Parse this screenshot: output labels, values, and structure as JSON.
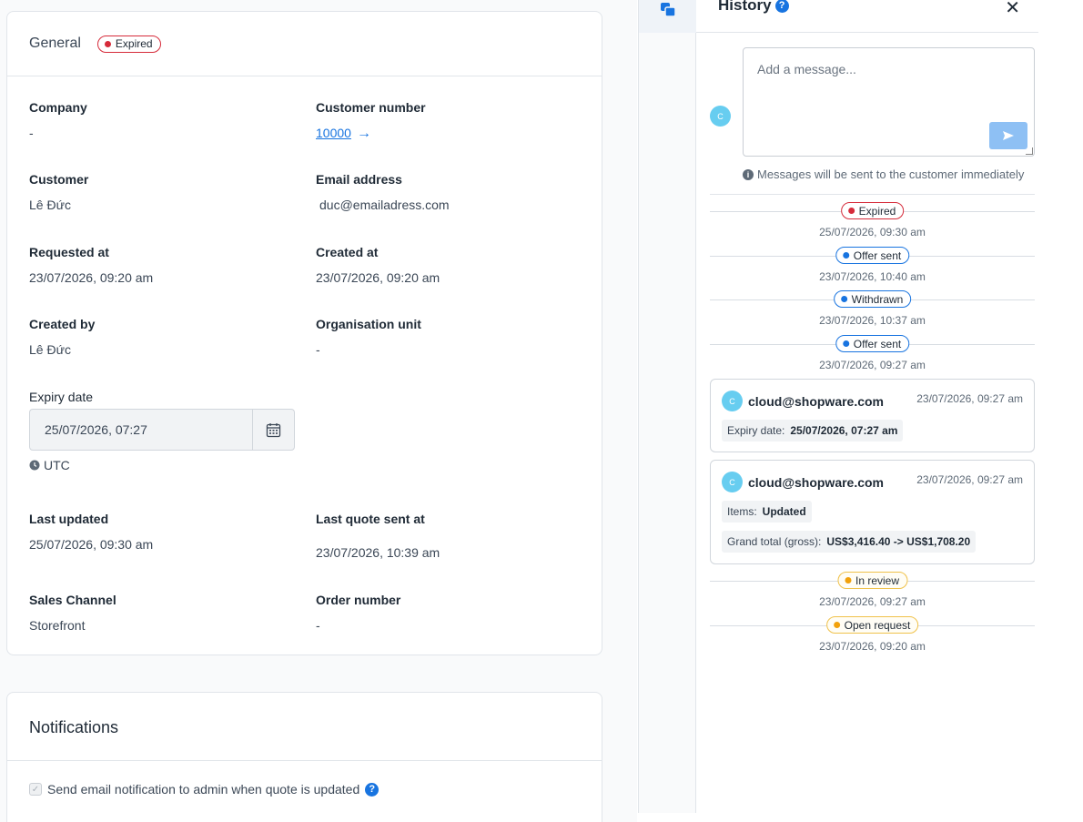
{
  "general": {
    "title": "General",
    "status": "Expired",
    "fields": {
      "company_label": "Company",
      "company_value": "-",
      "customer_number_label": "Customer number",
      "customer_number_value": "10000",
      "customer_label": "Customer",
      "customer_value": "Lê Đức",
      "email_label": "Email address",
      "email_value": "duc@emailadress.com",
      "requested_label": "Requested at",
      "requested_value": "23/07/2026, 09:20 am",
      "created_at_label": "Created at",
      "created_at_value": "23/07/2026, 09:20 am",
      "created_by_label": "Created by",
      "created_by_value": "Lê Đức",
      "org_unit_label": "Organisation unit",
      "org_unit_value": "-",
      "expiry_label": "Expiry date",
      "expiry_value": "25/07/2026, 07:27",
      "timezone": "UTC",
      "last_updated_label": "Last updated",
      "last_updated_value": "25/07/2026, 09:30 am",
      "last_quote_label": "Last quote sent at",
      "last_quote_value": "23/07/2026, 10:39 am",
      "sales_channel_label": "Sales Channel",
      "sales_channel_value": "Storefront",
      "order_number_label": "Order number",
      "order_number_value": "-"
    }
  },
  "notifications": {
    "title": "Notifications",
    "checkbox_label": "Send email notification to admin when quote is updated"
  },
  "history": {
    "title": "History",
    "close": "✕",
    "composer_placeholder": "Add a message...",
    "avatar_initial": "C",
    "note": "Messages will be sent to the customer immediately",
    "events_top": [
      {
        "status": "Expired",
        "time": "25/07/2026, 09:30 am",
        "color": "#d62b3a"
      },
      {
        "status": "Offer sent",
        "time": "23/07/2026, 10:40 am",
        "color": "#1874e0"
      },
      {
        "status": "Withdrawn",
        "time": "23/07/2026, 10:37 am",
        "color": "#1874e0"
      },
      {
        "status": "Offer sent",
        "time": "23/07/2026, 09:27 am",
        "color": "#1874e0"
      }
    ],
    "messages": [
      {
        "sender": "cloud@shopware.com",
        "time": "23/07/2026, 09:27 am",
        "chips": [
          {
            "label": "Expiry date:",
            "value": "25/07/2026, 07:27 am"
          }
        ]
      },
      {
        "sender": "cloud@shopware.com",
        "time": "23/07/2026, 09:27 am",
        "chips": [
          {
            "label": "Items:",
            "value": "Updated"
          },
          {
            "label": "Grand total (gross):",
            "value": "US$3,416.40 -> US$1,708.20"
          }
        ]
      }
    ],
    "events_bottom": [
      {
        "status": "In review",
        "time": "23/07/2026, 09:27 am",
        "color": "#f2a10a"
      },
      {
        "status": "Open request",
        "time": "23/07/2026, 09:20 am",
        "color": "#f2a10a"
      }
    ]
  },
  "colors": {
    "accent": "#1874e0",
    "expired": "#d62b3a",
    "pending": "#f2a10a",
    "avatar": "#67cdf0"
  }
}
